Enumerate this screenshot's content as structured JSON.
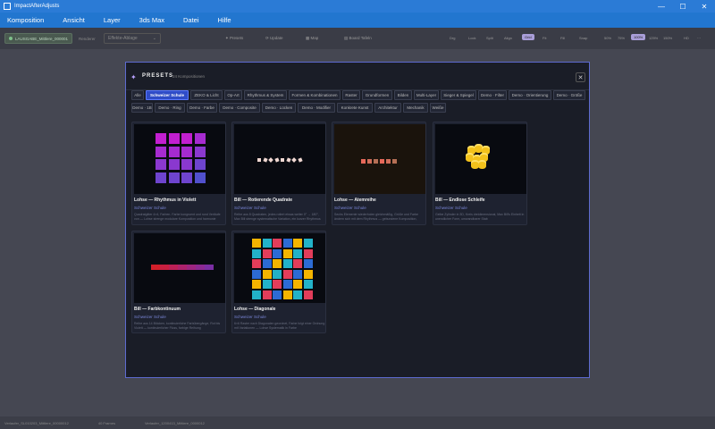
{
  "window": {
    "title": "ImpactAfterAdjusts",
    "minimize": "—",
    "maximize": "☐",
    "close": "✕"
  },
  "menu": [
    "Komposition",
    "Ansicht",
    "Layer",
    "3ds Max",
    "Datei",
    "Hilfe"
  ],
  "toolbar": {
    "chip": "LAUSGABE_Mittlere_000001",
    "label": "Renderer",
    "select_value": "Effekte-Ablage",
    "tools": [
      "Presets",
      "Update",
      "Map",
      "Board Tafeln"
    ],
    "view_buttons": [
      "Drg",
      "Lock",
      "Split",
      "Align",
      "Grid",
      "Fit",
      "Fill",
      "Snap"
    ],
    "zoom": [
      "50%",
      "75%",
      "100%",
      "125%",
      "150%"
    ],
    "zoom_active": "100%",
    "misc": [
      "HD",
      "⋯"
    ]
  },
  "status": [
    "Verlaufer_SL010203_Mittlere_00000012",
    "40 Frames",
    "Verlaufer_1200413_Mittlere_0000012"
  ],
  "modal": {
    "icon": "magic-wand-icon",
    "title": "PRESETS",
    "count": "24 Kompositionen",
    "close": "✕",
    "filters": [
      "Alle",
      "Schweizer Schule",
      "ZEKO & Licht",
      "Op-Art",
      "Rhythmus & System",
      "Formen & Kombinationen",
      "Raster",
      "Grundformen",
      "Bilden",
      "Multi-Layer",
      "Sieger & Spiegel",
      "Demo · Filter",
      "Demo · Orientierung",
      "Demo · Größe",
      "Demo · 1B",
      "Demo · Ring",
      "Demo · Farbe",
      "Demo · Composite",
      "Demo · Lücken",
      "Demo · Modifier",
      "Konkrete Kunst",
      "Architektur",
      "Mechanik",
      "Weiße"
    ],
    "active_filter": "Schweizer Schule",
    "cards": [
      {
        "title": "Lohse — Rhythmus in Violett",
        "author": "Schweizer Schule",
        "desc": "Quadratgitter 4×4, Farben. Farbe kongruent und rund Verläufe von — Lohse strenge modulare Komposition und harmonie"
      },
      {
        "title": "Bill — Rotierende Quadrate",
        "author": "Schweizer Schule",
        "desc": "Reihe aus 8 Quadraten, jedes rotiert etwas weiter 0° → 180°, Max Bill strenge systematische Variation, ein kurzer Rhythmus"
      },
      {
        "title": "Lohse — Atemreihe",
        "author": "Schweizer Schule",
        "desc": "Sechs Elemente wiederholen gleichmäßig, Größe und Farbe ändern sich mit dem Rhythmus — gebundene Komposition, warme Farben"
      },
      {
        "title": "Bill — Endlose Schleife",
        "author": "Schweizer Schule",
        "desc": "Gelbe Zylinder in 3D, Kreis dreidimensional, Max Bill's Einheit in unendlicher Form, umwandbarer Stab"
      },
      {
        "title": "Bill — Farbkontinuum",
        "author": "Schweizer Schule",
        "desc": "Reihe aus 14 Blöcken, kontinuierliche Farbübergänge, Rot bis Violett — kontinuierlicher Fluss, farbige Reihung"
      },
      {
        "title": "Lohse — Diagonale",
        "author": "Schweizer Schule",
        "desc": "6×6 Raster nach Diagonalen geordnet, Farbe folgt einer Ordnung mit Variationen — Lohse Systematik in Farbe"
      }
    ],
    "palette": {
      "violet": [
        "#c21fd0",
        "#a62bd0",
        "#8a38cf",
        "#6e44ce",
        "#5150cd"
      ],
      "row": [
        "#e7685a",
        "#d06d5a",
        "#b56f55"
      ],
      "spectrum": [
        "#d21f2a",
        "#c81f40",
        "#bc2056",
        "#ad226c",
        "#9d2580",
        "#8c2992",
        "#7b2ea3"
      ],
      "diag": [
        "#f4b400",
        "#22b2c8",
        "#e23d5a",
        "#2c6bd4"
      ]
    }
  }
}
